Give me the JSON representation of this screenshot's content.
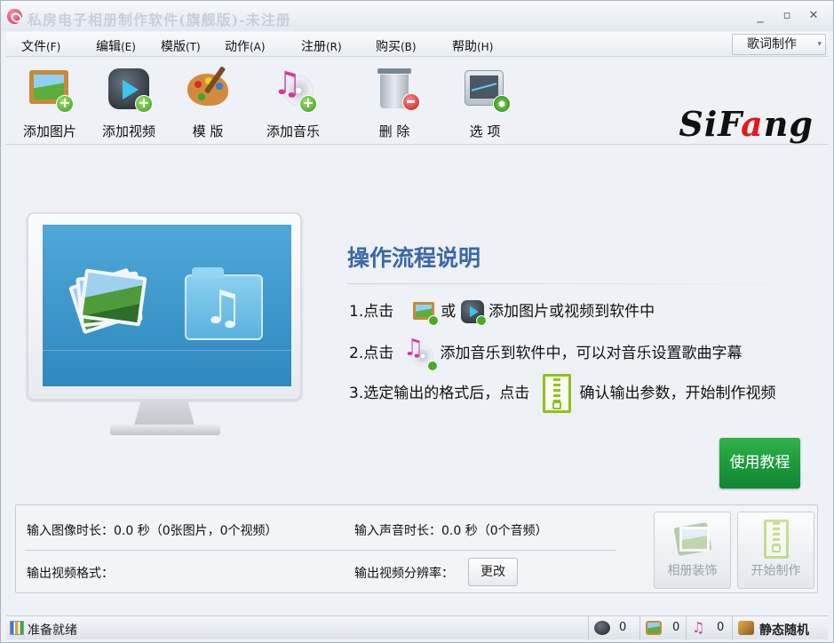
{
  "window": {
    "title": "私房电子相册制作软件(旗舰版)-未注册",
    "minimize": "_",
    "maximize": "▫",
    "close": "✕"
  },
  "menu": [
    {
      "label": "文件",
      "acc": "(F)"
    },
    {
      "label": "编辑",
      "acc": "(E)"
    },
    {
      "label": "模版",
      "acc": "(T)"
    },
    {
      "label": "动作",
      "acc": "(A)"
    },
    {
      "label": "注册",
      "acc": "(R)"
    },
    {
      "label": "购买",
      "acc": "(B)"
    },
    {
      "label": "帮助",
      "acc": "(H)"
    }
  ],
  "lyric_button": "歌词制作",
  "toolbar": [
    {
      "label": "添加图片",
      "icon": "add-picture-icon"
    },
    {
      "label": "添加视频",
      "icon": "add-video-icon"
    },
    {
      "label": "模 版",
      "icon": "palette-icon"
    },
    {
      "label": "添加音乐",
      "icon": "add-music-icon"
    },
    {
      "label": "删 除",
      "icon": "trash-icon"
    },
    {
      "label": "选 项",
      "icon": "options-icon"
    }
  ],
  "logo": {
    "part1": "SiF",
    "part2": "a",
    "part3": "ng"
  },
  "guide": {
    "title": "操作流程说明",
    "step1_a": "1.点击",
    "step1_or": "或",
    "step1_b": "添加图片或视频到软件中",
    "step2_a": "2.点击",
    "step2_b": "添加音乐到软件中，可以对音乐设置歌曲字幕",
    "step3_a": "3.选定输出的格式后，点击",
    "step3_b": "确认输出参数，开始制作视频"
  },
  "tutorial_button": "使用教程",
  "info": {
    "image_duration": "输入图像时长：0.0 秒（0张图片，0个视频）",
    "audio_duration": "输入声音时长：0.0 秒（0个音频）",
    "output_format": "输出视频格式：",
    "output_resolution": "输出视频分辨率：",
    "change_button": "更改",
    "decorate_button": "相册装饰",
    "start_button": "开始制作"
  },
  "status": {
    "text": "准备就绪",
    "video_count": "0",
    "image_count": "0",
    "music_count": "0",
    "mode": "静态随机"
  }
}
